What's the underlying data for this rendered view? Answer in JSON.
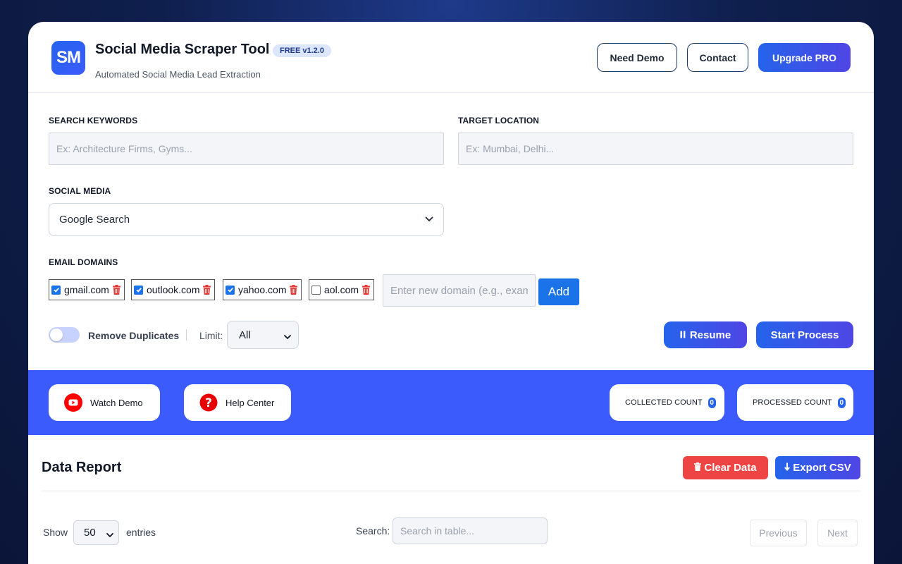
{
  "header": {
    "logo_text": "SM",
    "title": "Social Media Scraper Tool",
    "version_badge": "FREE v1.2.0",
    "subtitle": "Automated Social Media Lead Extraction",
    "buttons": {
      "demo": "Need Demo",
      "contact": "Contact",
      "upgrade": "Upgrade PRO"
    }
  },
  "form": {
    "keywords_label": "SEARCH KEYWORDS",
    "keywords_placeholder": "Ex: Architecture Firms, Gyms...",
    "location_label": "TARGET LOCATION",
    "location_placeholder": "Ex: Mumbai, Delhi...",
    "social_label": "SOCIAL MEDIA",
    "social_selected": "Google Search",
    "domains_label": "EMAIL DOMAINS",
    "domains": [
      {
        "name": "gmail.com",
        "checked": true
      },
      {
        "name": "outlook.com",
        "checked": true
      },
      {
        "name": "yahoo.com",
        "checked": true
      },
      {
        "name": "aol.com",
        "checked": false
      }
    ],
    "new_domain_placeholder": "Enter new domain (e.g., example.com)",
    "add_label": "Add",
    "remove_duplicates_label": "Remove Duplicates",
    "limit_label": "Limit:",
    "limit_selected": "All",
    "resume_label": "Resume",
    "start_label": "Start Process"
  },
  "band": {
    "watch_demo": "Watch Demo",
    "help_center": "Help Center",
    "collected_label": "COLLECTED COUNT",
    "collected_value": "0",
    "processed_label": "PROCESSED COUNT",
    "processed_value": "0"
  },
  "report": {
    "title": "Data Report",
    "clear_label": "Clear Data",
    "export_label": "Export CSV",
    "show_label": "Show",
    "entries_selected": "50",
    "entries_label": "entries",
    "search_label": "Search:",
    "search_placeholder": "Search in table...",
    "previous_label": "Previous",
    "next_label": "Next"
  },
  "colors": {
    "accent": "#2563eb",
    "band": "#3b5bfd",
    "danger": "#ef4444",
    "youtube": "#ff0000"
  },
  "icons": {
    "select": "chevron-down-icon",
    "domain_remove": "trash-icon",
    "resume": "pause-icon",
    "watch_demo": "youtube-icon",
    "help_center": "help-icon",
    "clear": "trash-icon",
    "export": "download-arrow-icon"
  }
}
